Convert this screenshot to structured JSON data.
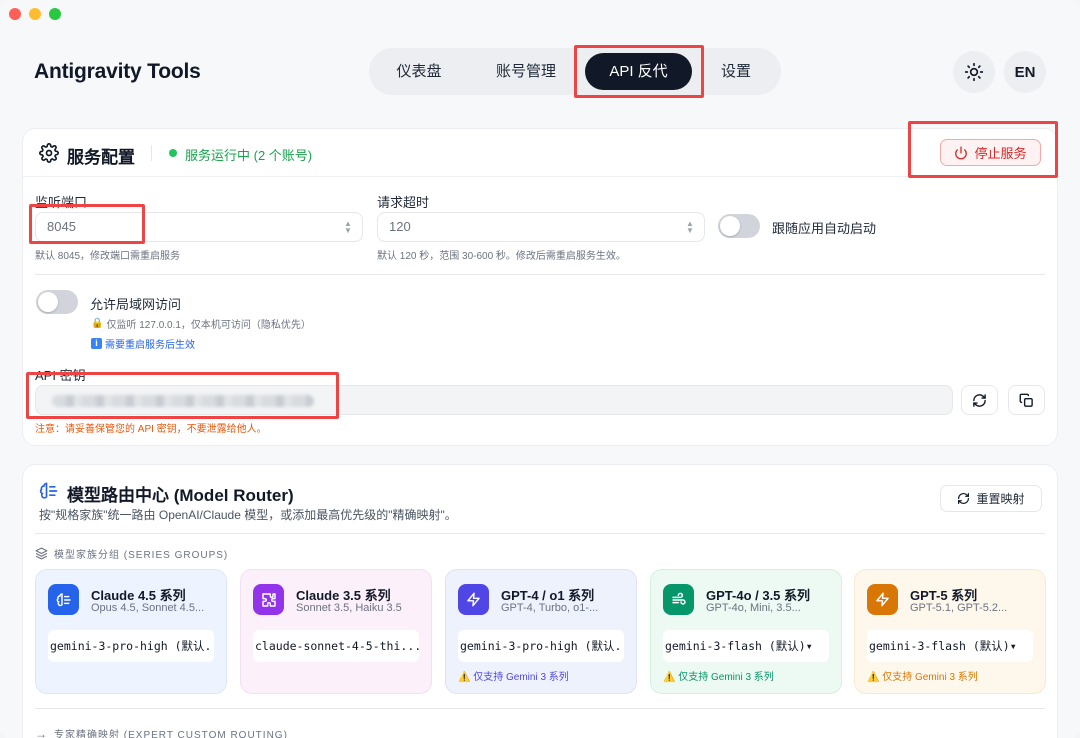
{
  "app": {
    "title": "Antigravity Tools"
  },
  "nav": {
    "dashboard": "仪表盘",
    "accounts": "账号管理",
    "api_proxy": "API 反代",
    "settings": "设置"
  },
  "header": {
    "lang": "EN"
  },
  "service": {
    "title": "服务配置",
    "status": "服务运行中 (2 个账号)",
    "stop_label": "停止服务",
    "port_label": "监听端口",
    "port_value": "8045",
    "port_hint": "默认 8045，修改端口需重启服务",
    "timeout_label": "请求超时",
    "timeout_value": "120",
    "timeout_hint": "默认 120 秒，范围 30-600 秒。修改后需重启服务生效。",
    "autostart_label": "跟随应用自动启动",
    "lan_label": "允许局域网访问",
    "lan_info": "仅监听 127.0.0.1，仅本机可访问（隐私优先）",
    "lan_restart": "需要重启服务后生效",
    "apikey_label": "API 密钥",
    "apikey_warning": "注意：请妥善保管您的 API 密钥，不要泄露给他人。"
  },
  "router": {
    "title": "模型路由中心 (Model Router)",
    "subtitle": "按\"规格家族\"统一路由 OpenAI/Claude 模型，或添加最高优先级的\"精确映射\"。",
    "reset_label": "重置映射",
    "series_header": "模型家族分组 (SERIES GROUPS)",
    "expert_header": "专家精确映射 (EXPERT CUSTOM ROUTING)",
    "groups": [
      {
        "name": "Claude 4.5 系列",
        "desc": "Opus 4.5, Sonnet 4.5...",
        "model": "gemini-3-pro-high (默认...",
        "note": ""
      },
      {
        "name": "Claude 3.5 系列",
        "desc": "Sonnet 3.5, Haiku 3.5",
        "model": "claude-sonnet-4-5-thi...",
        "note": ""
      },
      {
        "name": "GPT-4 / o1 系列",
        "desc": "GPT-4, Turbo, o1-...",
        "model": "gemini-3-pro-high (默认...",
        "note": "仅支持 Gemini 3 系列"
      },
      {
        "name": "GPT-4o / 3.5 系列",
        "desc": "GPT-4o, Mini, 3.5...",
        "model": "gemini-3-flash (默认)▾",
        "note": "仅支持 Gemini 3 系列"
      },
      {
        "name": "GPT-5 系列",
        "desc": "GPT-5.1, GPT-5.2...",
        "model": "gemini-3-flash (默认)▾",
        "note": "仅支持 Gemini 3 系列"
      }
    ]
  },
  "colors": {
    "accent": "#111827",
    "danger": "#dc2626",
    "success": "#22c55e",
    "warning": "#ea580c",
    "highlight": "#ef4444"
  }
}
